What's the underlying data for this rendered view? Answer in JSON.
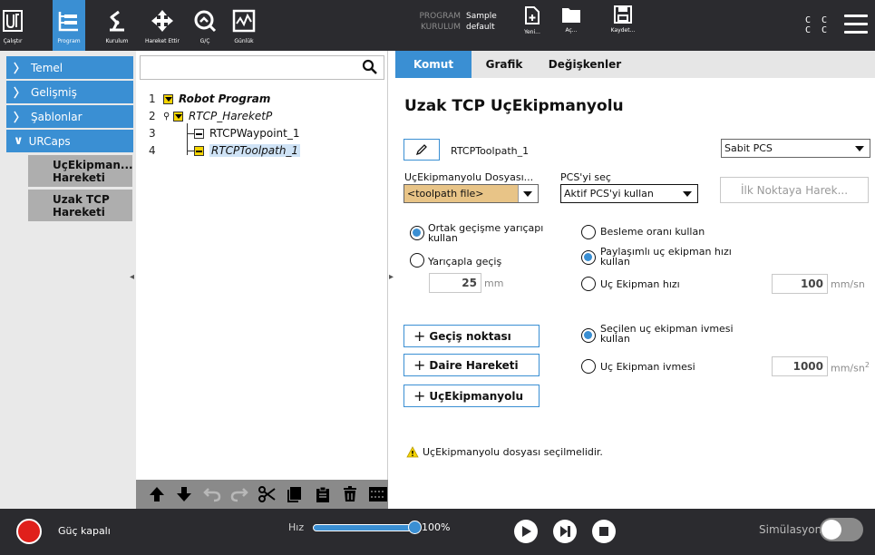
{
  "header": {
    "tabs": [
      {
        "label": "Çalıştır",
        "icon": "ur-logo-icon"
      },
      {
        "label": "Program",
        "icon": "program-icon",
        "active": true
      },
      {
        "label": "Kurulum",
        "icon": "robot-arm-icon"
      },
      {
        "label": "Hareket Ettir",
        "icon": "move-arrows-icon"
      },
      {
        "label": "G/Ç",
        "icon": "io-icon"
      },
      {
        "label": "Günlük",
        "icon": "log-icon"
      }
    ],
    "program_key": "PROGRAM",
    "program_value": "Sample",
    "installation_key": "KURULUM",
    "installation_value": "default",
    "file_buttons": [
      {
        "label": "Yeni...",
        "icon": "new-file-icon"
      },
      {
        "label": "Aç...",
        "icon": "folder-icon"
      },
      {
        "label": "Kaydet...",
        "icon": "save-icon"
      }
    ],
    "cc_lines": [
      "C C",
      "C C"
    ]
  },
  "nav": {
    "items": [
      "Temel",
      "Gelişmiş",
      "Şablonlar",
      "URCaps"
    ],
    "subitems": [
      "UçEkipman... Hareketi",
      "Uzak TCP Hareketi"
    ]
  },
  "tree": {
    "search_placeholder": "",
    "rows": [
      {
        "num": "1",
        "label": "Robot Program"
      },
      {
        "num": "2",
        "label": "RTCP_HareketP"
      },
      {
        "num": "3",
        "label": "RTCPWaypoint_1"
      },
      {
        "num": "4",
        "label": "RTCPToolpath_1"
      }
    ]
  },
  "panel": {
    "tabs": [
      "Komut",
      "Grafik",
      "Değişkenler"
    ],
    "title": "Uzak TCP UçEkipmanyolu",
    "node_name": "RTCPToolpath_1",
    "pcs_dropdown": "Sabit PCS",
    "toolpath_file_label": "UçEkipmanyolu Dosyası...",
    "toolpath_file_value": "<toolpath file>",
    "pcs_select_label": "PCS'yi seç",
    "pcs_select_value": "Aktif PCS'yi kullan",
    "first_point_button": "İlk Noktaya Harek...",
    "blend_common": "Ortak geçişme yarıçapı kullan",
    "blend_radius": "Yarıçapla geçiş",
    "blend_value": "25",
    "blend_unit": "mm",
    "feed_rate": "Besleme oranı kullan",
    "shared_speed": "Paylaşımlı uç ekipman hızı kullan",
    "tool_speed": "Uç Ekipman hızı",
    "tool_speed_value": "100",
    "tool_speed_unit": "mm/sn",
    "add_waypoint": "Geçiş noktası",
    "add_circle": "Daire Hareketi",
    "add_toolpath": "UçEkipmanyolu",
    "selected_accel": "Seçilen uç ekipman ivmesi kullan",
    "tool_accel": "Uç Ekipman ivmesi",
    "tool_accel_value": "1000",
    "tool_accel_unit": "mm/sn",
    "tool_accel_unit_sup": "2",
    "warning": "UçEkipmanyolu dosyası seçilmelidir."
  },
  "footer": {
    "power_label": "Güç kapalı",
    "speed_label": "Hız",
    "speed_value": "100%",
    "sim_label": "Simülasyon"
  },
  "colors": {
    "accent": "#3a8fd3",
    "header_bg": "#2b2b2f",
    "tree_yellow": "#f5d400",
    "sand": "#e8c487",
    "power_red": "#e0201b"
  }
}
